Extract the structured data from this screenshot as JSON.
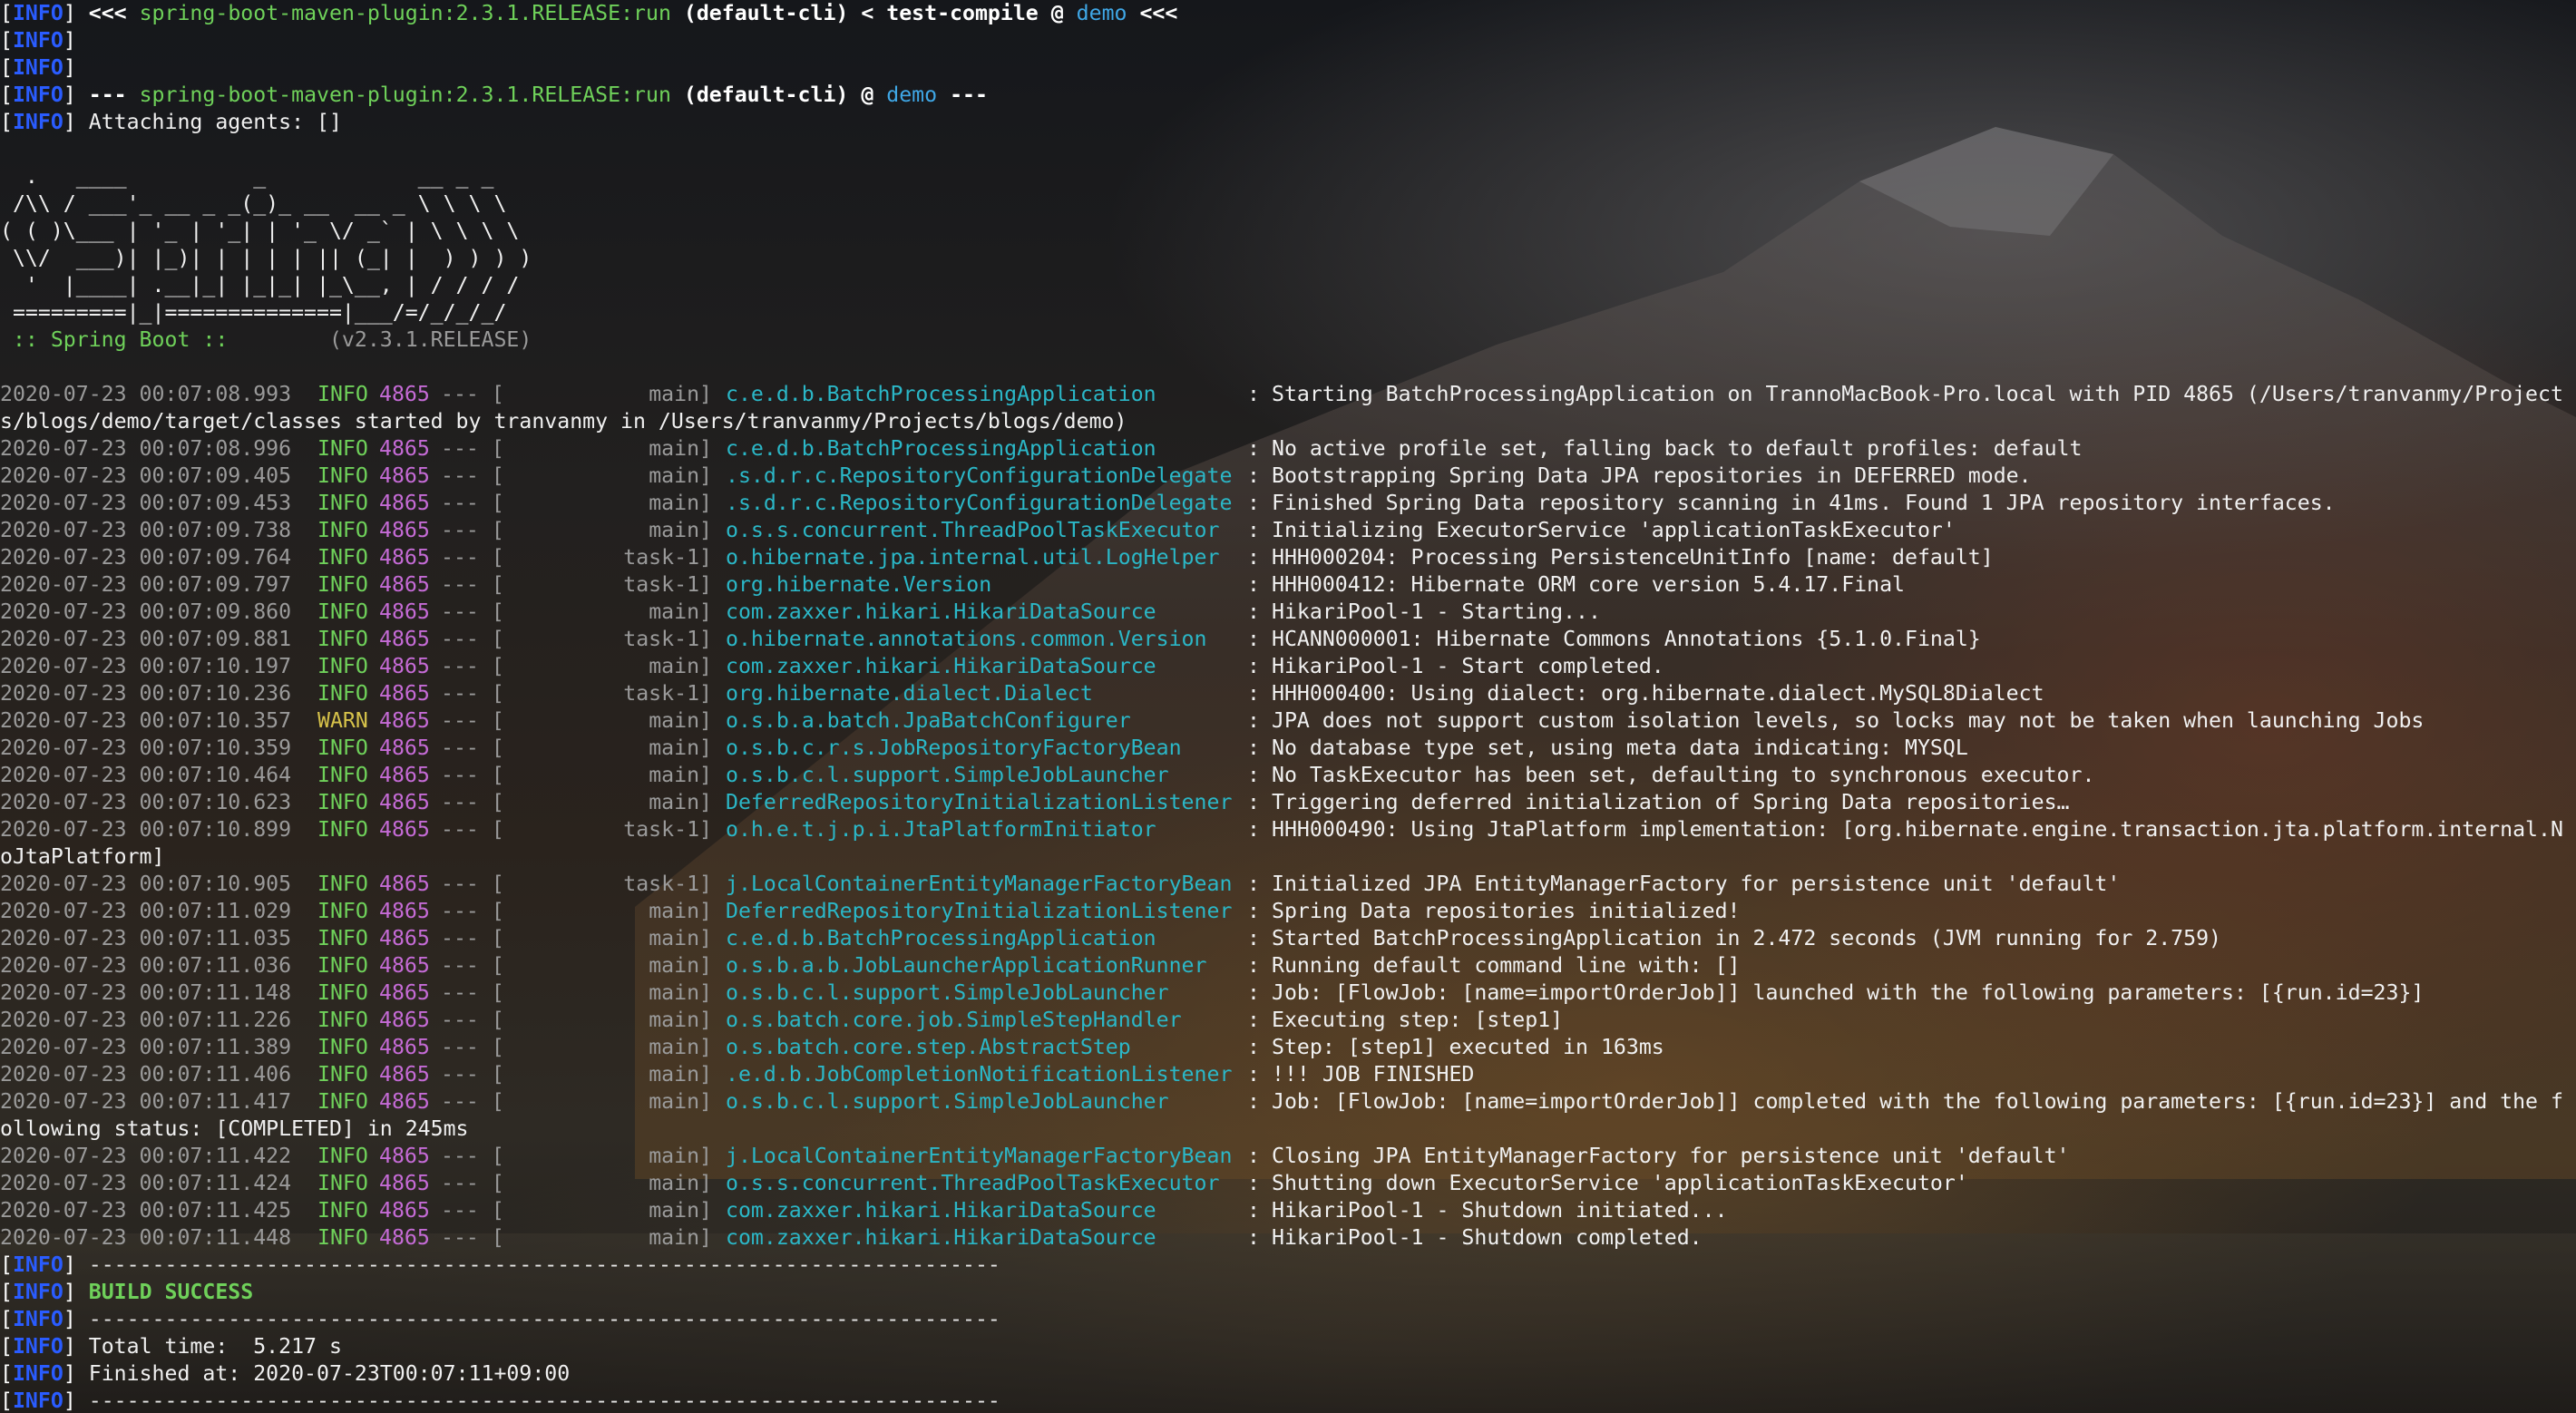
{
  "colors": {
    "info_tag": "#2a5cff",
    "plugin_green": "#6fd15a",
    "project_blue": "#3fa7e6",
    "logger_cyan": "#2bb7c7",
    "pid_magenta": "#c56bd6",
    "warn_yellow": "#d6c24a",
    "timestamp_gray": "#9a9a9a"
  },
  "maven_header": [
    {
      "tag": "INFO",
      "parts": [
        {
          "t": " <<< ",
          "c": "bold"
        },
        {
          "t": "spring-boot-maven-plugin:2.3.1.RELEASE:run",
          "c": "green"
        },
        {
          "t": " (default-cli) < test-compile @ ",
          "c": "bold"
        },
        {
          "t": "demo",
          "c": "blue"
        },
        {
          "t": " <<<",
          "c": "bold"
        }
      ]
    },
    {
      "tag": "INFO",
      "parts": []
    },
    {
      "tag": "INFO",
      "parts": []
    },
    {
      "tag": "INFO",
      "parts": [
        {
          "t": " --- ",
          "c": "bold"
        },
        {
          "t": "spring-boot-maven-plugin:2.3.1.RELEASE:run",
          "c": "green"
        },
        {
          "t": " (default-cli)",
          "c": "bold"
        },
        {
          "t": " @ ",
          "c": "bold"
        },
        {
          "t": "demo",
          "c": "blue"
        },
        {
          "t": " ---",
          "c": "bold"
        }
      ]
    },
    {
      "tag": "INFO",
      "parts": [
        {
          "t": " Attaching agents: []",
          "c": "msg"
        }
      ]
    }
  ],
  "banner": [
    "",
    "  .   ____          _            __ _ _",
    " /\\\\ / ___'_ __ _ _(_)_ __  __ _ \\ \\ \\ \\",
    "( ( )\\___ | '_ | '_| | '_ \\/ _` | \\ \\ \\ \\",
    " \\\\/  ___)| |_)| | | | | || (_| |  ) ) ) )",
    "  '  |____| .__|_| |_|_| |_\\__, | / / / /",
    " =========|_|==============|___/=/_/_/_/"
  ],
  "spring_boot_label": " :: Spring Boot :: ",
  "spring_boot_version": "       (v2.3.1.RELEASE)",
  "log_lines": [
    {
      "ts": "2020-07-23 00:07:08.993",
      "lvl": "INFO",
      "pid": "4865",
      "thread": "main]",
      "logger": "c.e.d.b.BatchProcessingApplication",
      "msg": "Starting BatchProcessingApplication on TrannoMacBook-Pro.local with PID 4865 (/Users/tranvanmy/Project"
    },
    {
      "cont": "s/blogs/demo/target/classes started by tranvanmy in /Users/tranvanmy/Projects/blogs/demo)"
    },
    {
      "ts": "2020-07-23 00:07:08.996",
      "lvl": "INFO",
      "pid": "4865",
      "thread": "main]",
      "logger": "c.e.d.b.BatchProcessingApplication",
      "msg": "No active profile set, falling back to default profiles: default"
    },
    {
      "ts": "2020-07-23 00:07:09.405",
      "lvl": "INFO",
      "pid": "4865",
      "thread": "main]",
      "logger": ".s.d.r.c.RepositoryConfigurationDelegate",
      "msg": "Bootstrapping Spring Data JPA repositories in DEFERRED mode."
    },
    {
      "ts": "2020-07-23 00:07:09.453",
      "lvl": "INFO",
      "pid": "4865",
      "thread": "main]",
      "logger": ".s.d.r.c.RepositoryConfigurationDelegate",
      "msg": "Finished Spring Data repository scanning in 41ms. Found 1 JPA repository interfaces."
    },
    {
      "ts": "2020-07-23 00:07:09.738",
      "lvl": "INFO",
      "pid": "4865",
      "thread": "main]",
      "logger": "o.s.s.concurrent.ThreadPoolTaskExecutor",
      "msg": "Initializing ExecutorService 'applicationTaskExecutor'"
    },
    {
      "ts": "2020-07-23 00:07:09.764",
      "lvl": "INFO",
      "pid": "4865",
      "thread": "task-1]",
      "logger": "o.hibernate.jpa.internal.util.LogHelper",
      "msg": "HHH000204: Processing PersistenceUnitInfo [name: default]"
    },
    {
      "ts": "2020-07-23 00:07:09.797",
      "lvl": "INFO",
      "pid": "4865",
      "thread": "task-1]",
      "logger": "org.hibernate.Version",
      "msg": "HHH000412: Hibernate ORM core version 5.4.17.Final"
    },
    {
      "ts": "2020-07-23 00:07:09.860",
      "lvl": "INFO",
      "pid": "4865",
      "thread": "main]",
      "logger": "com.zaxxer.hikari.HikariDataSource",
      "msg": "HikariPool-1 - Starting..."
    },
    {
      "ts": "2020-07-23 00:07:09.881",
      "lvl": "INFO",
      "pid": "4865",
      "thread": "task-1]",
      "logger": "o.hibernate.annotations.common.Version",
      "msg": "HCANN000001: Hibernate Commons Annotations {5.1.0.Final}"
    },
    {
      "ts": "2020-07-23 00:07:10.197",
      "lvl": "INFO",
      "pid": "4865",
      "thread": "main]",
      "logger": "com.zaxxer.hikari.HikariDataSource",
      "msg": "HikariPool-1 - Start completed."
    },
    {
      "ts": "2020-07-23 00:07:10.236",
      "lvl": "INFO",
      "pid": "4865",
      "thread": "task-1]",
      "logger": "org.hibernate.dialect.Dialect",
      "msg": "HHH000400: Using dialect: org.hibernate.dialect.MySQL8Dialect"
    },
    {
      "ts": "2020-07-23 00:07:10.357",
      "lvl": "WARN",
      "pid": "4865",
      "thread": "main]",
      "logger": "o.s.b.a.batch.JpaBatchConfigurer",
      "msg": "JPA does not support custom isolation levels, so locks may not be taken when launching Jobs"
    },
    {
      "ts": "2020-07-23 00:07:10.359",
      "lvl": "INFO",
      "pid": "4865",
      "thread": "main]",
      "logger": "o.s.b.c.r.s.JobRepositoryFactoryBean",
      "msg": "No database type set, using meta data indicating: MYSQL"
    },
    {
      "ts": "2020-07-23 00:07:10.464",
      "lvl": "INFO",
      "pid": "4865",
      "thread": "main]",
      "logger": "o.s.b.c.l.support.SimpleJobLauncher",
      "msg": "No TaskExecutor has been set, defaulting to synchronous executor."
    },
    {
      "ts": "2020-07-23 00:07:10.623",
      "lvl": "INFO",
      "pid": "4865",
      "thread": "main]",
      "logger": "DeferredRepositoryInitializationListener",
      "msg": "Triggering deferred initialization of Spring Data repositories…"
    },
    {
      "ts": "2020-07-23 00:07:10.899",
      "lvl": "INFO",
      "pid": "4865",
      "thread": "task-1]",
      "logger": "o.h.e.t.j.p.i.JtaPlatformInitiator",
      "msg": "HHH000490: Using JtaPlatform implementation: [org.hibernate.engine.transaction.jta.platform.internal.N"
    },
    {
      "cont": "oJtaPlatform]"
    },
    {
      "ts": "2020-07-23 00:07:10.905",
      "lvl": "INFO",
      "pid": "4865",
      "thread": "task-1]",
      "logger": "j.LocalContainerEntityManagerFactoryBean",
      "msg": "Initialized JPA EntityManagerFactory for persistence unit 'default'"
    },
    {
      "ts": "2020-07-23 00:07:11.029",
      "lvl": "INFO",
      "pid": "4865",
      "thread": "main]",
      "logger": "DeferredRepositoryInitializationListener",
      "msg": "Spring Data repositories initialized!"
    },
    {
      "ts": "2020-07-23 00:07:11.035",
      "lvl": "INFO",
      "pid": "4865",
      "thread": "main]",
      "logger": "c.e.d.b.BatchProcessingApplication",
      "msg": "Started BatchProcessingApplication in 2.472 seconds (JVM running for 2.759)"
    },
    {
      "ts": "2020-07-23 00:07:11.036",
      "lvl": "INFO",
      "pid": "4865",
      "thread": "main]",
      "logger": "o.s.b.a.b.JobLauncherApplicationRunner",
      "msg": "Running default command line with: []"
    },
    {
      "ts": "2020-07-23 00:07:11.148",
      "lvl": "INFO",
      "pid": "4865",
      "thread": "main]",
      "logger": "o.s.b.c.l.support.SimpleJobLauncher",
      "msg": "Job: [FlowJob: [name=importOrderJob]] launched with the following parameters: [{run.id=23}]"
    },
    {
      "ts": "2020-07-23 00:07:11.226",
      "lvl": "INFO",
      "pid": "4865",
      "thread": "main]",
      "logger": "o.s.batch.core.job.SimpleStepHandler",
      "msg": "Executing step: [step1]"
    },
    {
      "ts": "2020-07-23 00:07:11.389",
      "lvl": "INFO",
      "pid": "4865",
      "thread": "main]",
      "logger": "o.s.batch.core.step.AbstractStep",
      "msg": "Step: [step1] executed in 163ms"
    },
    {
      "ts": "2020-07-23 00:07:11.406",
      "lvl": "INFO",
      "pid": "4865",
      "thread": "main]",
      "logger": ".e.d.b.JobCompletionNotificationListener",
      "msg": "!!! JOB FINISHED"
    },
    {
      "ts": "2020-07-23 00:07:11.417",
      "lvl": "INFO",
      "pid": "4865",
      "thread": "main]",
      "logger": "o.s.b.c.l.support.SimpleJobLauncher",
      "msg": "Job: [FlowJob: [name=importOrderJob]] completed with the following parameters: [{run.id=23}] and the f"
    },
    {
      "cont": "ollowing status: [COMPLETED] in 245ms"
    },
    {
      "ts": "2020-07-23 00:07:11.422",
      "lvl": "INFO",
      "pid": "4865",
      "thread": "main]",
      "logger": "j.LocalContainerEntityManagerFactoryBean",
      "msg": "Closing JPA EntityManagerFactory for persistence unit 'default'"
    },
    {
      "ts": "2020-07-23 00:07:11.424",
      "lvl": "INFO",
      "pid": "4865",
      "thread": "main]",
      "logger": "o.s.s.concurrent.ThreadPoolTaskExecutor",
      "msg": "Shutting down ExecutorService 'applicationTaskExecutor'"
    },
    {
      "ts": "2020-07-23 00:07:11.425",
      "lvl": "INFO",
      "pid": "4865",
      "thread": "main]",
      "logger": "com.zaxxer.hikari.HikariDataSource",
      "msg": "HikariPool-1 - Shutdown initiated..."
    },
    {
      "ts": "2020-07-23 00:07:11.448",
      "lvl": "INFO",
      "pid": "4865",
      "thread": "main]",
      "logger": "com.zaxxer.hikari.HikariDataSource",
      "msg": "HikariPool-1 - Shutdown completed."
    }
  ],
  "maven_footer": [
    {
      "tag": "INFO",
      "parts": [
        {
          "t": " ------------------------------------------------------------------------",
          "c": "dash"
        }
      ]
    },
    {
      "tag": "INFO",
      "parts": [
        {
          "t": " BUILD SUCCESS",
          "c": "build-success"
        }
      ]
    },
    {
      "tag": "INFO",
      "parts": [
        {
          "t": " ------------------------------------------------------------------------",
          "c": "dash"
        }
      ]
    },
    {
      "tag": "INFO",
      "parts": [
        {
          "t": " Total time:  5.217 s",
          "c": "msg"
        }
      ]
    },
    {
      "tag": "INFO",
      "parts": [
        {
          "t": " Finished at: 2020-07-23T00:07:11+09:00",
          "c": "msg"
        }
      ]
    },
    {
      "tag": "INFO",
      "parts": [
        {
          "t": " ------------------------------------------------------------------------",
          "c": "dash"
        }
      ]
    }
  ],
  "log_sep": "--- [",
  "colon": ":"
}
